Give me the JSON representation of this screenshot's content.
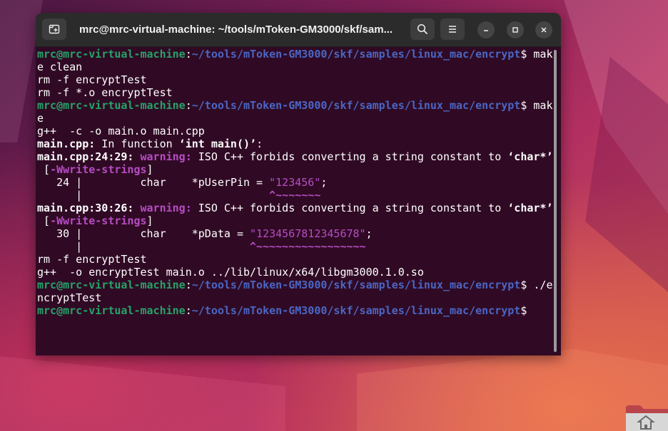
{
  "window": {
    "title": "mrc@mrc-virtual-machine: ~/tools/mToken-GM3000/skf/sam...",
    "icons": {
      "new_tab": "new-tab-icon",
      "search": "search-icon",
      "menu": "hamburger-menu-icon",
      "minimize": "minimize-icon",
      "maximize": "maximize-icon",
      "close": "close-icon"
    }
  },
  "terminal": {
    "prompt_user": "mrc@mrc-virtual-machine",
    "prompt_sep": ":",
    "prompt_path": "~/tools/mToken-GM3000/skf/samples/linux_mac/encrypt",
    "prompt_dollar": "$",
    "lines": [
      "$ mak",
      "e clean",
      "rm -f encryptTest",
      "rm -f *.o encryptTest",
      "$ mak",
      "e",
      "g++  -c -o main.o main.cpp",
      "main.cpp:",
      " In function ",
      "‘int main()’",
      ":",
      "main.cpp:24:29:",
      "warning:",
      " ISO C++ forbids converting a string constant to ",
      "‘char*’",
      " [",
      "-Wwrite-strings",
      "]",
      "   24 |         char    *pUserPin = ",
      "\"123456\"",
      ";",
      "      |                             ",
      "^~~~~~~~",
      "main.cpp:30:26:",
      "warning:",
      " ISO C++ forbids converting a string constant to ",
      "‘char*’",
      " [",
      "-Wwrite-strings",
      "]",
      "   30 |         char    *pData = ",
      "\"1234567812345678\"",
      ";",
      "      |                          ",
      "^~~~~~~~~~~~~~~~~~",
      "rm -f encryptTest",
      "g++  -o encryptTest main.o ../lib/linux/x64/libgm3000.1.0.so",
      "$ ./e",
      "ncryptTest",
      "$"
    ]
  },
  "desktop": {
    "folder_icon": "home-folder-icon"
  },
  "colors": {
    "terminal_bg": "#300a24",
    "prompt_user": "#26a269",
    "prompt_path": "#4a66c4",
    "warning": "#b64cc4",
    "titlebar": "#2b2b2b"
  }
}
